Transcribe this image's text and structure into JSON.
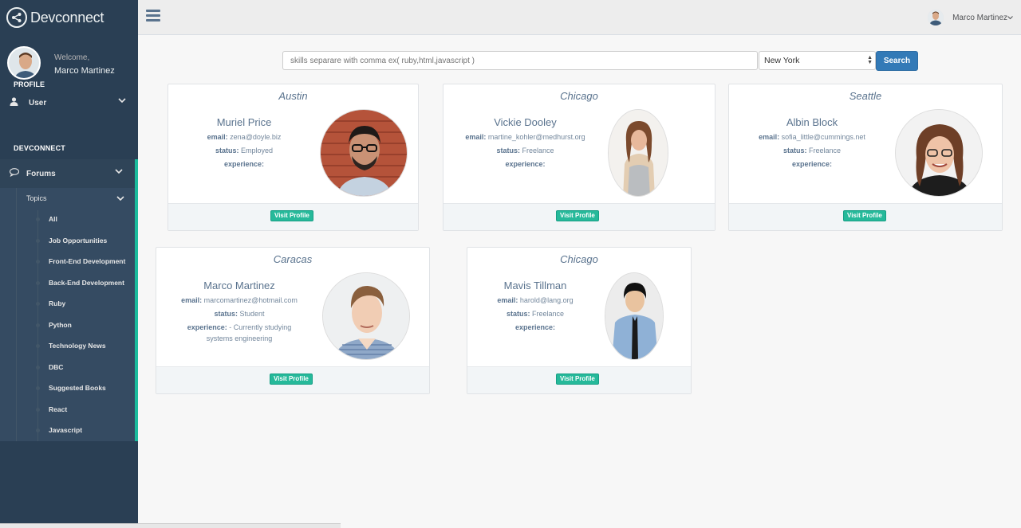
{
  "brand": {
    "name": "Devconnect",
    "icon": "share-icon"
  },
  "profile": {
    "welcome": "Welcome,",
    "name": "Marco Martinez",
    "label": "PROFILE"
  },
  "sidebar": {
    "user_menu": {
      "label": "User",
      "icon": "user-icon"
    },
    "section_title": "DEVCONNECT",
    "forums": {
      "label": "Forums",
      "icon": "comments-icon"
    },
    "topics_label": "Topics",
    "topics": [
      "All",
      "Job Opportunities",
      "Front-End Development",
      "Back-End Development",
      "Ruby",
      "Python",
      "Technology News",
      "DBC",
      "Suggested Books",
      "React",
      "Javascript"
    ]
  },
  "topnav": {
    "user_name": "Marco Martinez"
  },
  "search": {
    "placeholder": "skills separare with comma ex( ruby,html,javascript )",
    "city_selected": "New York",
    "button_label": "Search"
  },
  "cards": [
    {
      "city": "Austin",
      "name": "Muriel Price",
      "email_label": "email:",
      "email": "zena@doyle.biz",
      "status_label": "status:",
      "status": "Employed",
      "experience_label": "experience:",
      "experience": "",
      "button": "Visit Profile"
    },
    {
      "city": "Chicago",
      "name": "Vickie Dooley",
      "email_label": "email:",
      "email": "martine_kohler@medhurst.org",
      "status_label": "status:",
      "status": "Freelance",
      "experience_label": "experience:",
      "experience": "",
      "button": "Visit Profile"
    },
    {
      "city": "Seattle",
      "name": "Albin Block",
      "email_label": "email:",
      "email": "sofia_little@cummings.net",
      "status_label": "status:",
      "status": "Freelance",
      "experience_label": "experience:",
      "experience": "",
      "button": "Visit Profile"
    },
    {
      "city": "Caracas",
      "name": "Marco Martinez",
      "email_label": "email:",
      "email": "marcomartinez@hotmail.com",
      "status_label": "status:",
      "status": "Student",
      "experience_label": "experience:",
      "experience": "- Currently studying systems engineering",
      "button": "Visit Profile"
    },
    {
      "city": "Chicago",
      "name": "Mavis Tillman",
      "email_label": "email:",
      "email": "harold@lang.org",
      "status_label": "status:",
      "status": "Freelance",
      "experience_label": "experience:",
      "experience": "",
      "button": "Visit Profile"
    }
  ],
  "colors": {
    "sidebar": "#2a3f54",
    "accent": "#1abb9c",
    "button_green": "#26b99a",
    "search_blue": "#337ab7"
  }
}
